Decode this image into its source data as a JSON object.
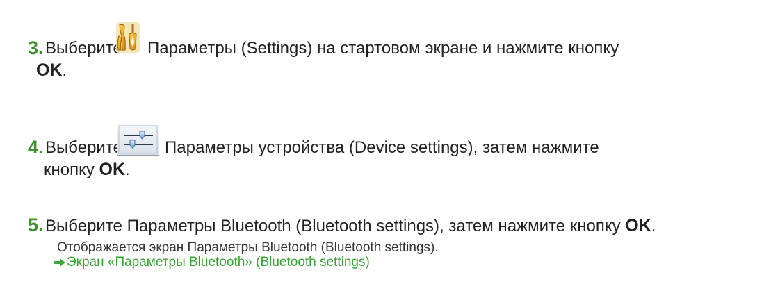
{
  "steps": [
    {
      "number": "3.",
      "prefix": "Выберите",
      "icon": "settings-tools-icon",
      "rest": "Параметры (Settings) на стартовом экране и нажмите кнопку",
      "line2_bold": "OK",
      "line2_end": "."
    },
    {
      "number": "4.",
      "prefix": "Выберите",
      "icon": "device-settings-sliders-icon",
      "rest": "Параметры устройства (Device settings), затем нажмите",
      "line2_text": "кнопку",
      "line2_bold": "OK",
      "line2_end": "."
    },
    {
      "number": "5.",
      "text": "Выберите Параметры Bluetooth (Bluetooth settings), затем нажмите кнопку",
      "bold": "OK",
      "end": ".",
      "note": "Отображается экран Параметры Bluetooth (Bluetooth settings).",
      "link_text": "Экран «Параметры Bluetooth» (Bluetooth settings)",
      "link_icon": "right-arrow-icon"
    }
  ],
  "colors": {
    "step_number": "#3f8f2c",
    "link": "#35a334",
    "text": "#222222",
    "icon_orange": "#e8a41c"
  }
}
